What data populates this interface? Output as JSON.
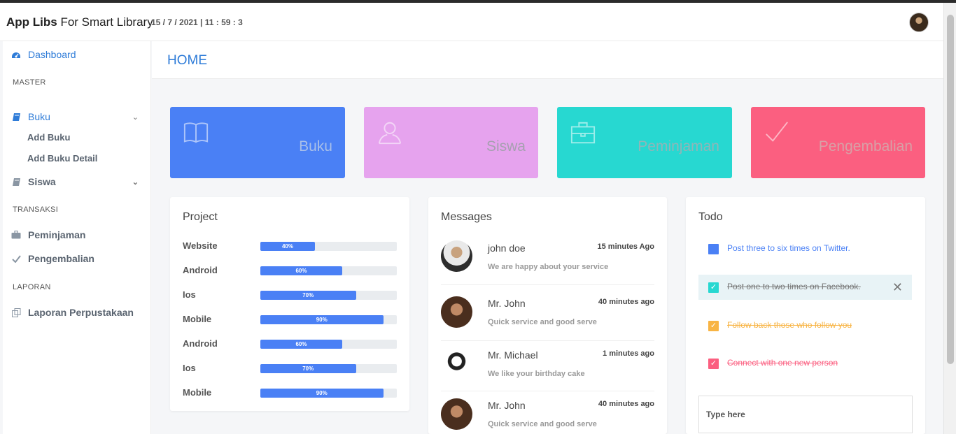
{
  "header": {
    "app_name": "App Libs",
    "app_subtitle": "For Smart Library",
    "datetime": "15 / 7 / 2021 | 11 : 59 : 3"
  },
  "sidebar": {
    "dashboard": "Dashboard",
    "section_master": "MASTER",
    "buku": "Buku",
    "add_buku": "Add Buku",
    "add_buku_detail": "Add Buku Detail",
    "siswa": "Siswa",
    "section_transaksi": "TRANSAKSI",
    "peminjaman": "Peminjaman",
    "pengembalian": "Pengembalian",
    "section_laporan": "LAPORAN",
    "laporan": "Laporan Perpustakaan"
  },
  "main": {
    "title": "HOME",
    "cards": [
      {
        "label": "Buku",
        "icon": "book-icon",
        "bg": "#4a80f5",
        "text_color": "#a8bfe9"
      },
      {
        "label": "Siswa",
        "icon": "user-icon",
        "bg": "#e6a3ee",
        "text_color": "#a6a0b0"
      },
      {
        "label": "Peminjaman",
        "icon": "briefcase-icon",
        "bg": "#27d8d1",
        "text_color": "#8fb6b8"
      },
      {
        "label": "Pengembalian",
        "icon": "checkmark-icon",
        "bg": "#fb5f80",
        "text_color": "#d8a0a6"
      }
    ]
  },
  "project": {
    "title": "Project",
    "rows": [
      {
        "name": "Website",
        "percent": 40,
        "label": "40%"
      },
      {
        "name": "Android",
        "percent": 60,
        "label": "60%"
      },
      {
        "name": "Ios",
        "percent": 70,
        "label": "70%"
      },
      {
        "name": "Mobile",
        "percent": 90,
        "label": "90%"
      },
      {
        "name": "Android",
        "percent": 60,
        "label": "60%"
      },
      {
        "name": "Ios",
        "percent": 70,
        "label": "70%"
      },
      {
        "name": "Mobile",
        "percent": 90,
        "label": "90%"
      }
    ]
  },
  "messages": {
    "title": "Messages",
    "items": [
      {
        "name": "john doe",
        "time": "15 minutes Ago",
        "text": "We are happy about your service"
      },
      {
        "name": "Mr. John",
        "time": "40 minutes ago",
        "text": "Quick service and good serve"
      },
      {
        "name": "Mr. Michael",
        "time": "1 minutes ago",
        "text": "We like your birthday cake"
      },
      {
        "name": "Mr. John",
        "time": "40 minutes ago",
        "text": "Quick service and good serve"
      }
    ]
  },
  "todo": {
    "title": "Todo",
    "items": [
      {
        "text": "Post three to six times on Twitter.",
        "done": false,
        "color": "#4a80f5"
      },
      {
        "text": "Post one to two times on Facebook.",
        "done": true,
        "color": "#27d8d1"
      },
      {
        "text": "Follow back those who follow you",
        "done": true,
        "color": "#f8b444"
      },
      {
        "text": "Connect with one new person",
        "done": true,
        "color": "#fb5f80"
      }
    ],
    "input_placeholder": "Type here"
  }
}
